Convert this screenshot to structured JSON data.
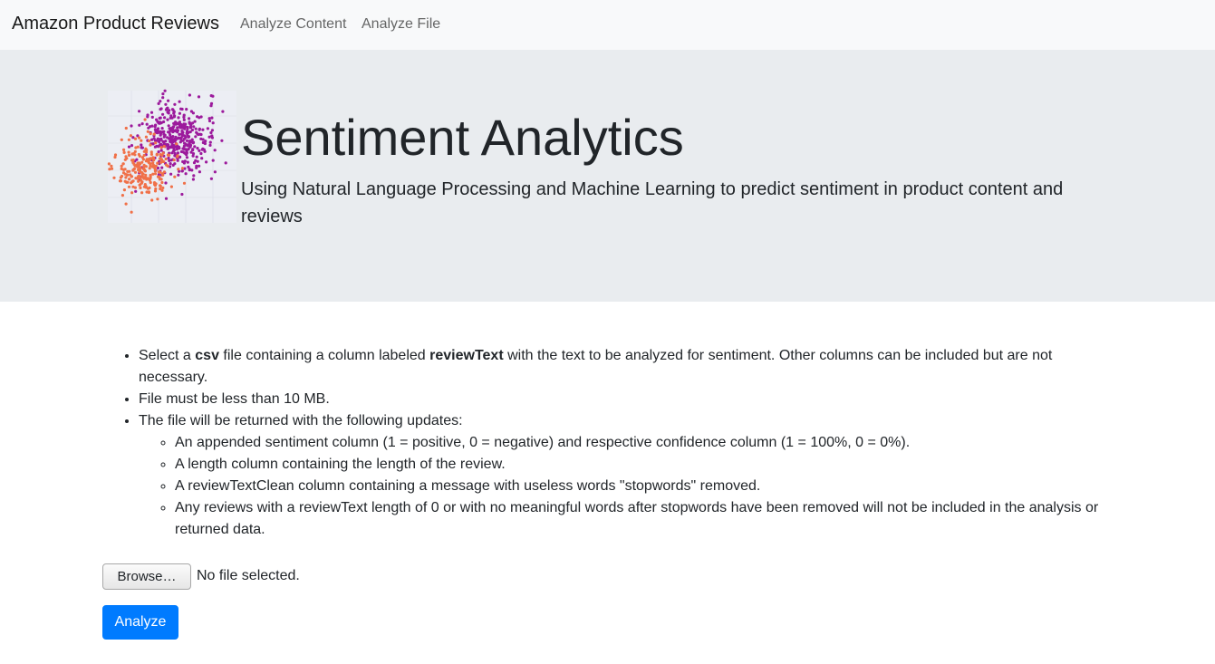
{
  "navbar": {
    "brand": "Amazon Product Reviews",
    "links": [
      "Analyze Content",
      "Analyze File"
    ]
  },
  "hero": {
    "title": "Sentiment Analytics",
    "subtitle": "Using Natural Language Processing and Machine Learning to predict sentiment in product content and reviews",
    "logo_colors": {
      "positive": "#9c1a9c",
      "negative": "#f07048"
    }
  },
  "instructions": {
    "item1": {
      "pre": "Select a ",
      "bold1": "csv",
      "mid": " file containing a column labeled ",
      "bold2": "reviewText",
      "post": " with the text to be analyzed for sentiment. Other columns can be included but are not necessary."
    },
    "item2": "File must be less than 10 MB.",
    "item3": "The file will be returned with the following updates:",
    "subitems": [
      "An appended sentiment column (1 = positive, 0 = negative) and respective confidence column (1 = 100%, 0 = 0%).",
      "A length column containing the length of the review.",
      "A reviewTextClean column containing a message with useless words \"stopwords\" removed.",
      "Any reviews with a reviewText length of 0 or with no meaningful words after stopwords have been removed will not be included in the analysis or returned data."
    ]
  },
  "file_input": {
    "button_label": "Browse…",
    "status": "No file selected."
  },
  "analyze_button": "Analyze",
  "colors": {
    "primary": "#007bff",
    "navbar_bg": "#f8f9fa",
    "jumbotron_bg": "#e9ecef"
  }
}
